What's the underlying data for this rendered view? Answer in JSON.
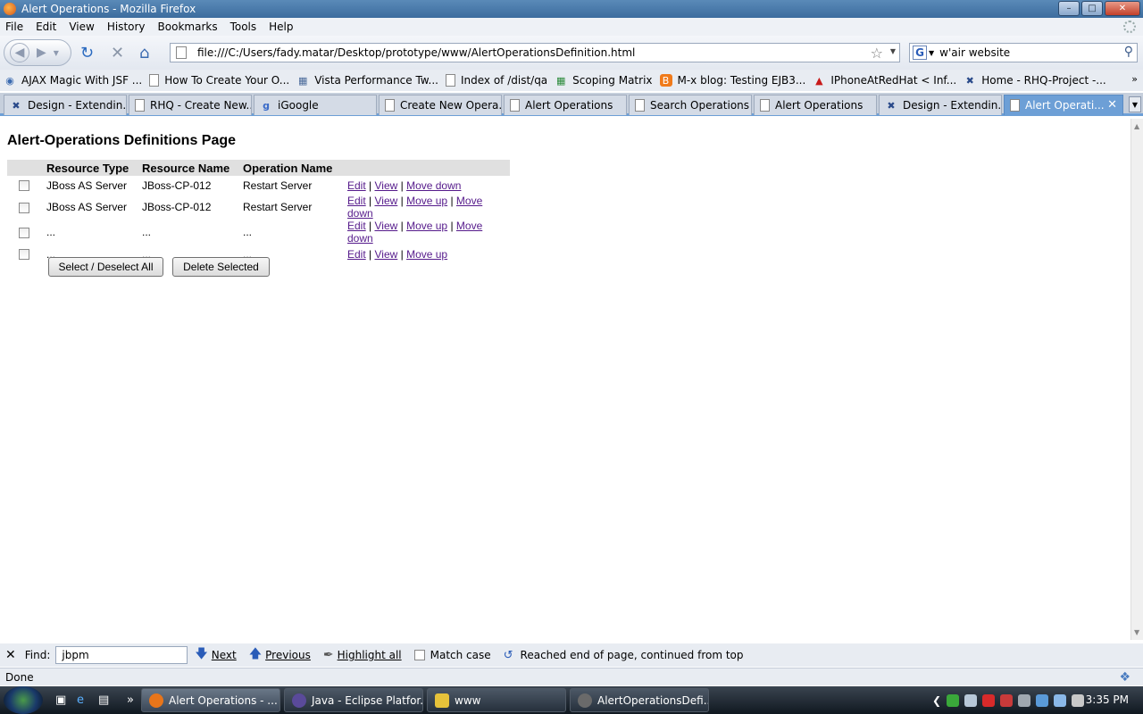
{
  "window": {
    "title": "Alert Operations - Mozilla Firefox",
    "controls": [
      "minimize",
      "maximize",
      "close"
    ]
  },
  "menu": [
    "File",
    "Edit",
    "View",
    "History",
    "Bookmarks",
    "Tools",
    "Help"
  ],
  "nav": {
    "url": "file:///C:/Users/fady.matar/Desktop/prototype/www/AlertOperationsDefinition.html",
    "search_value": "w'air website",
    "search_engine_letter": "G"
  },
  "bookmarks": [
    {
      "label": "AJAX Magic With JSF ...",
      "icon": "wordpress-icon"
    },
    {
      "label": "How To Create Your O...",
      "icon": "page-icon"
    },
    {
      "label": "Vista Performance Tw...",
      "icon": "network-icon"
    },
    {
      "label": "Index of /dist/qa",
      "icon": "page-icon"
    },
    {
      "label": "Scoping Matrix",
      "icon": "spreadsheet-icon"
    },
    {
      "label": "M-x blog: Testing EJB3...",
      "icon": "blogger-icon"
    },
    {
      "label": "IPhoneAtRedHat < Inf...",
      "icon": "redhat-icon"
    },
    {
      "label": "Home - RHQ-Project -...",
      "icon": "confluence-icon"
    }
  ],
  "tabs": [
    {
      "label": "Design - Extendin...",
      "icon": "confluence-icon",
      "active": false
    },
    {
      "label": "RHQ - Create New...",
      "icon": "page-icon",
      "active": false
    },
    {
      "label": "iGoogle",
      "icon": "google-icon",
      "active": false
    },
    {
      "label": "Create New Opera...",
      "icon": "page-icon",
      "active": false
    },
    {
      "label": "Alert Operations",
      "icon": "page-icon",
      "active": false
    },
    {
      "label": "Search Operations",
      "icon": "page-icon",
      "active": false
    },
    {
      "label": "Alert Operations",
      "icon": "page-icon",
      "active": false
    },
    {
      "label": "Design - Extendin...",
      "icon": "confluence-icon",
      "active": false
    },
    {
      "label": "Alert Operati...",
      "icon": "page-icon",
      "active": true
    }
  ],
  "page": {
    "title": "Alert-Operations Definitions Page",
    "columns": [
      "Resource Type",
      "Resource Name",
      "Operation Name"
    ],
    "rows": [
      {
        "type": "JBoss AS Server",
        "name": "JBoss-CP-012",
        "operation": "Restart Server",
        "edit": "Edit",
        "view": "View",
        "move_up": "",
        "move_down": "Move down"
      },
      {
        "type": "JBoss AS Server",
        "name": "JBoss-CP-012",
        "operation": "Restart Server",
        "edit": "Edit",
        "view": "View",
        "move_up": "Move up",
        "move_down": "Move down"
      },
      {
        "type": "...",
        "name": "...",
        "operation": "...",
        "edit": "Edit",
        "view": "View",
        "move_up": "Move up",
        "move_down": "Move down"
      },
      {
        "type": "...",
        "name": "...",
        "operation": "...",
        "edit": "Edit",
        "view": "View",
        "move_up": "Move up",
        "move_down": ""
      }
    ],
    "select_all_label": "Select / Deselect All",
    "delete_label": "Delete Selected"
  },
  "findbar": {
    "label": "Find:",
    "value": "jbpm",
    "next": "Next",
    "previous": "Previous",
    "highlight": "Highlight all",
    "match_case": "Match case",
    "message": "Reached end of page, continued from top"
  },
  "status": "Done",
  "taskbar": {
    "tasks": [
      {
        "label": "Alert Operations - ...",
        "active": true,
        "color": "#e8751a"
      },
      {
        "label": "Java - Eclipse Platfor...",
        "active": false,
        "color": "#5a4a9a"
      },
      {
        "label": "www",
        "active": false,
        "color": "#e6c23a"
      },
      {
        "label": "AlertOperationsDefi...",
        "active": false,
        "color": "#6a6a6a"
      }
    ],
    "clock": "3:35 PM"
  }
}
